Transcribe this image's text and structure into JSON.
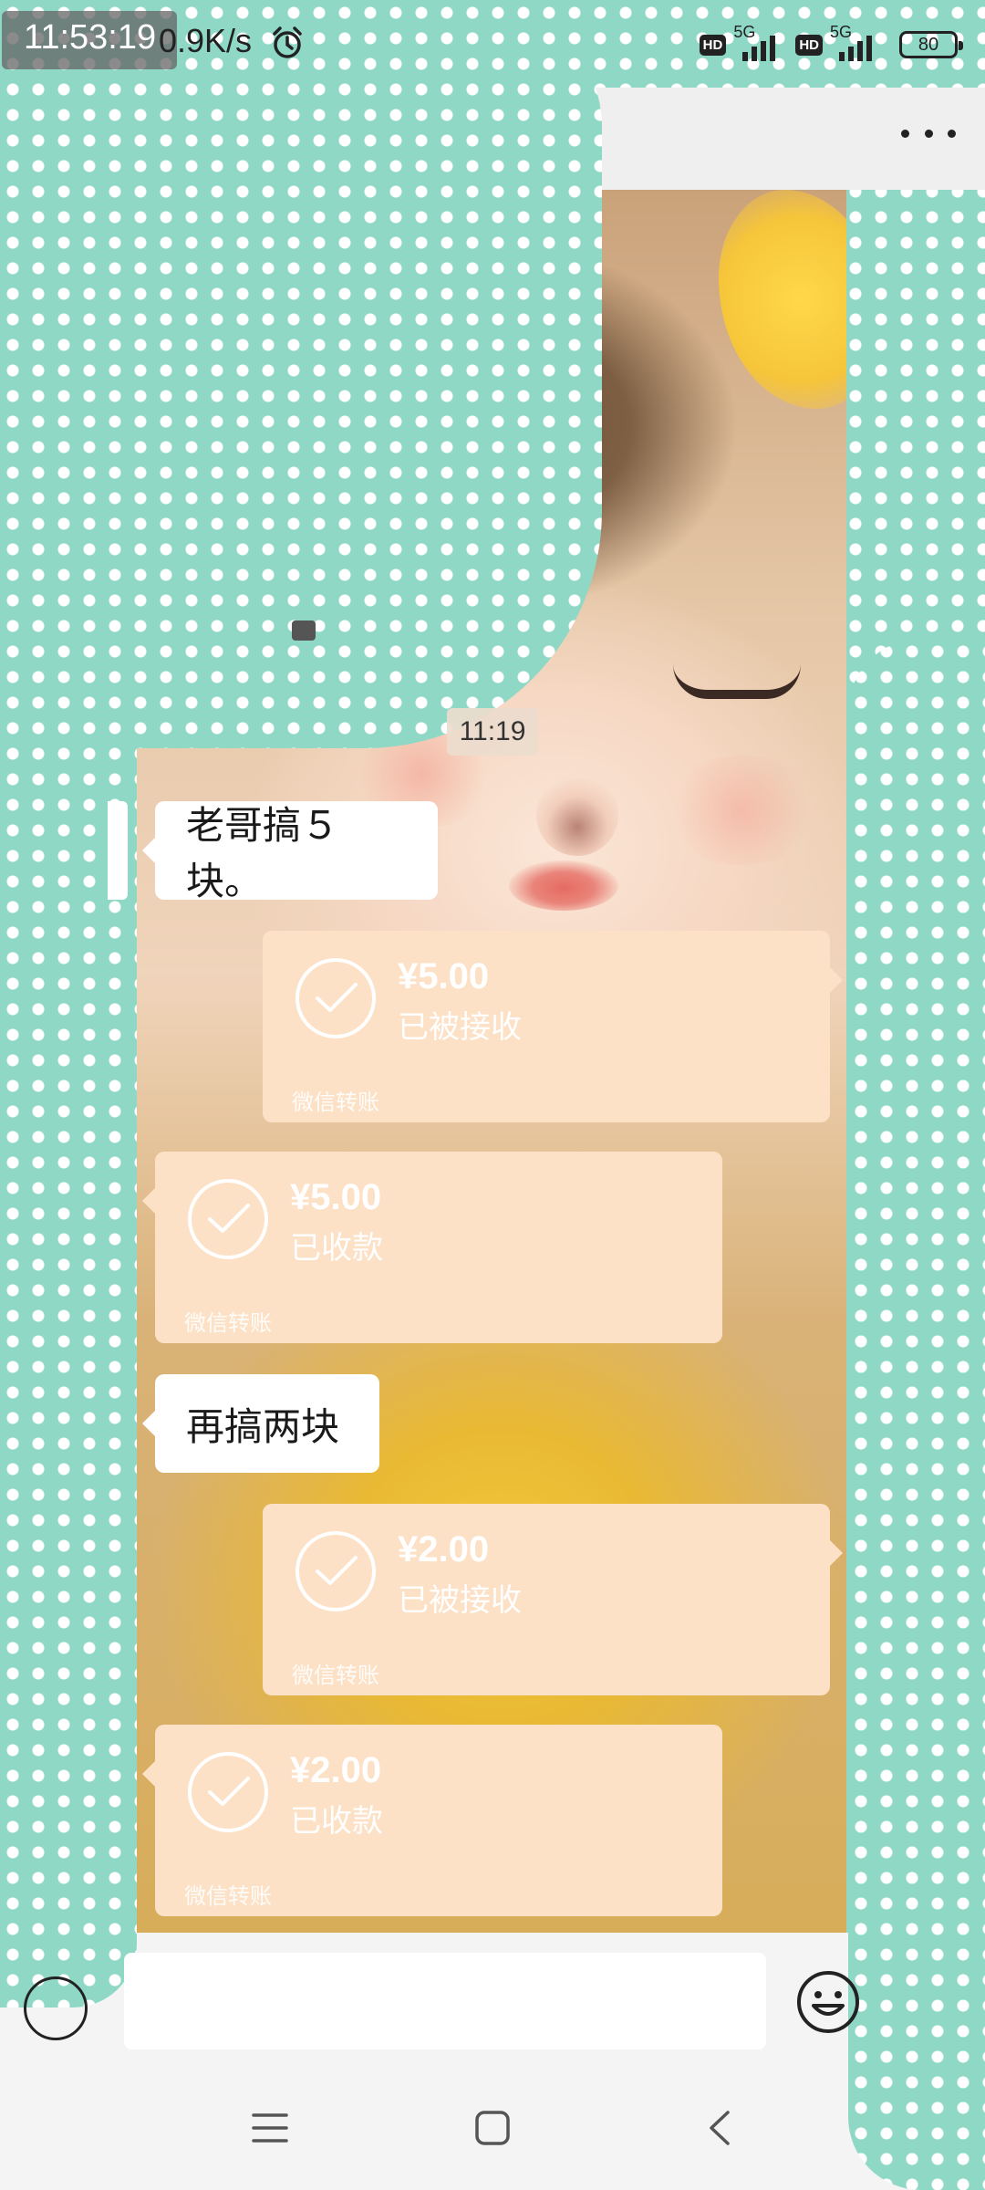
{
  "status_bar": {
    "time": "11:53:19",
    "net_speed": "0.9K/s",
    "alarm_icon": "alarm-clock-icon",
    "hd_label": "HD",
    "network_label": "5G",
    "battery": "80"
  },
  "header": {
    "more_icon": "more-dots-icon"
  },
  "chat": {
    "timestamp": "11:19",
    "messages": [
      {
        "type": "text",
        "direction": "incoming",
        "text": "老哥搞５块。"
      },
      {
        "type": "transfer",
        "direction": "outgoing",
        "amount": "¥5.00",
        "status": "已被接收",
        "label": "微信转账"
      },
      {
        "type": "transfer",
        "direction": "incoming",
        "amount": "¥5.00",
        "status": "已收款",
        "label": "微信转账"
      },
      {
        "type": "text",
        "direction": "incoming",
        "text": "再搞两块"
      },
      {
        "type": "transfer",
        "direction": "outgoing",
        "amount": "¥2.00",
        "status": "已被接收",
        "label": "微信转账"
      },
      {
        "type": "transfer",
        "direction": "incoming",
        "amount": "¥2.00",
        "status": "已收款",
        "label": "微信转账"
      }
    ]
  },
  "input_bar": {
    "voice_icon": "voice-icon",
    "input_value": "",
    "emoji_icon": "emoji-icon"
  },
  "nav_bar": {
    "menu_icon": "menu-icon",
    "home_icon": "home-square-icon",
    "back_icon": "back-chevron-icon"
  },
  "colors": {
    "transfer_bubble": "#fde1c6",
    "dots_background": "#8fd8c6"
  }
}
